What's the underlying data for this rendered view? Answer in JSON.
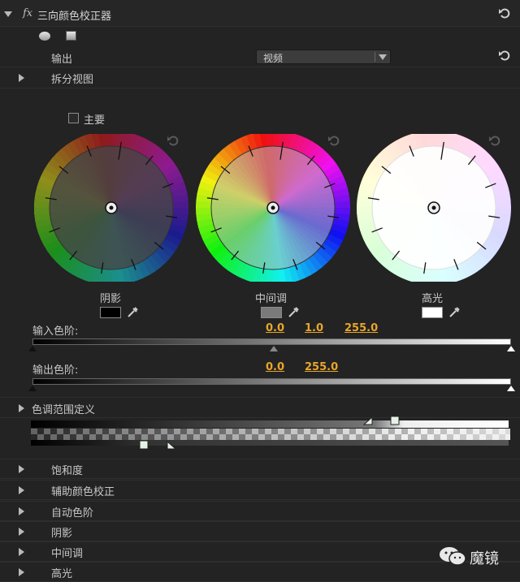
{
  "effect": {
    "fx_symbol": "fx",
    "title": "三向颜色校正器"
  },
  "output": {
    "label": "输出",
    "selected": "视频"
  },
  "split_view": {
    "label": "拆分视图"
  },
  "master": {
    "label": "主要"
  },
  "wheels": [
    {
      "label": "阴影",
      "swatch": "#000000"
    },
    {
      "label": "中间调",
      "swatch": "#7a7a7a"
    },
    {
      "label": "高光",
      "swatch": "#ffffff"
    }
  ],
  "input_levels": {
    "label": "输入色阶:",
    "black": "0.0",
    "gamma": "1.0",
    "white": "255.0"
  },
  "output_levels": {
    "label": "输出色阶:",
    "black": "0.0",
    "white": "255.0"
  },
  "tonal_range": {
    "label": "色调范围定义"
  },
  "sections": [
    {
      "label": "饱和度"
    },
    {
      "label": "辅助颜色校正"
    },
    {
      "label": "自动色阶"
    },
    {
      "label": "阴影"
    },
    {
      "label": "中间调"
    },
    {
      "label": "高光"
    }
  ],
  "watermark": {
    "text": "魔镜"
  }
}
